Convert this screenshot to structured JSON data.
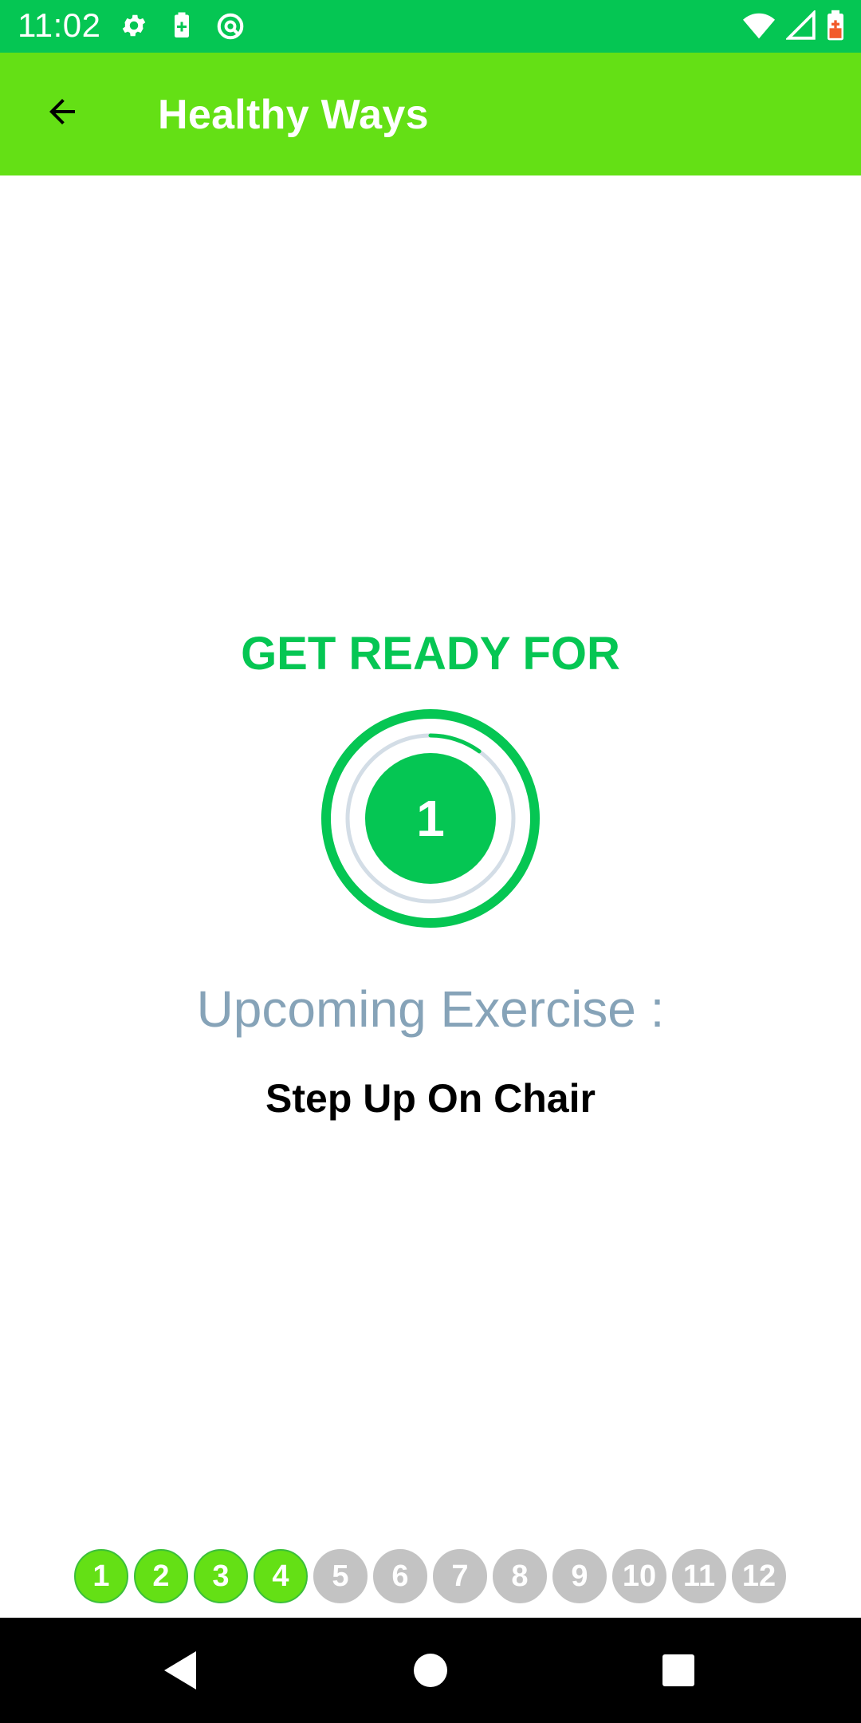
{
  "status_bar": {
    "time": "11:02",
    "icons": [
      "gear-icon",
      "battery-saver-icon",
      "data-saver-icon",
      "wifi-icon",
      "cell-signal-icon",
      "battery-low-icon"
    ]
  },
  "app_bar": {
    "title": "Healthy Ways",
    "back_icon": "arrow-back-icon"
  },
  "main": {
    "heading": "GET READY FOR",
    "countdown": "1",
    "countdown_progress": 0.1,
    "upcoming_label": "Upcoming Exercise :",
    "exercise_name": "Step Up On Chair"
  },
  "steps": {
    "items": [
      "1",
      "2",
      "3",
      "4",
      "5",
      "6",
      "7",
      "8",
      "9",
      "10",
      "11",
      "12"
    ],
    "completed": 4
  },
  "nav_bar": {
    "icons": [
      "back-triangle-icon",
      "home-circle-icon",
      "recents-square-icon"
    ]
  },
  "colors": {
    "status_bar": "#05c653",
    "app_bar": "#64e015",
    "accent_green": "#05c653",
    "step_done": "#64e015",
    "step_pending": "#c3c3c3",
    "upcoming_text": "#86a3b8"
  }
}
